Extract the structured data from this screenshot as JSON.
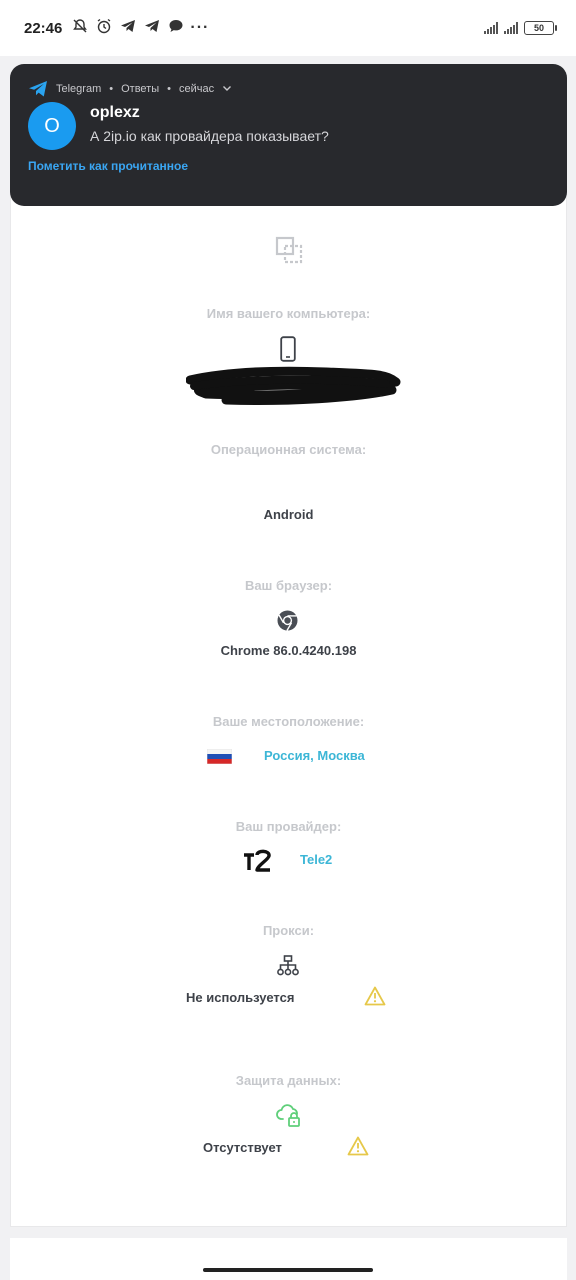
{
  "status_bar": {
    "time": "22:46",
    "left_icons": [
      "bell-off-icon",
      "alarm-icon",
      "telegram-icon",
      "telegram-icon",
      "chat-icon"
    ],
    "more": "···",
    "battery": "50"
  },
  "notification": {
    "app": "Telegram",
    "category": "Ответы",
    "time": "сейчас",
    "avatar_letter": "O",
    "sender": "oplexz",
    "message": "А 2ip.io как провайдера показывает?",
    "action": "Пометить как прочитанное",
    "background": "#28292d",
    "accent": "#3aa6f3"
  },
  "info": {
    "computer_name": {
      "label": "Имя вашего компьютера:",
      "icon": "smartphone-icon"
    },
    "os": {
      "label": "Операционная система:",
      "value": "Android"
    },
    "browser": {
      "label": "Ваш браузер:",
      "icon": "chrome-icon",
      "value": "Chrome 86.0.4240.198"
    },
    "location": {
      "label": "Ваше местоположение:",
      "icon": "flag-russia-icon",
      "value": "Россия, Москва"
    },
    "provider": {
      "label": "Ваш провайдер:",
      "logo": "t2",
      "value": "Tele2"
    },
    "proxy": {
      "label": "Прокси:",
      "icon": "network-icon",
      "value": "Не используется",
      "status_icon": "warning-icon"
    },
    "data_protection": {
      "label": "Защита данных:",
      "icon": "cloud-lock-icon",
      "value": "Отсутствует",
      "status_icon": "warning-icon"
    }
  },
  "colors": {
    "label": "#c6c8cc",
    "value": "#3e4249",
    "link": "#3cb6d6",
    "warning": "#e6c84a",
    "cloud": "#5fcf7a"
  }
}
